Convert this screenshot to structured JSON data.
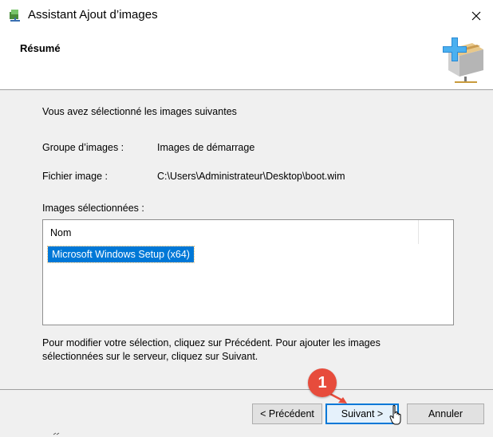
{
  "window": {
    "title": "Assistant Ajout d’images",
    "close_icon": "close-icon",
    "app_icon": "network-wizard-icon"
  },
  "header": {
    "title": "Résumé",
    "icon": "add-image-box-icon"
  },
  "summary": {
    "intro": "Vous avez sélectionné les images suivantes",
    "group_label": "Groupe d’images :",
    "group_value": "Images de démarrage",
    "file_label": "Fichier image :",
    "file_value": "C:\\Users\\Administrateur\\Desktop\\boot.wim",
    "selected_label": "Images sélectionnées :"
  },
  "image_list": {
    "column": "Nom",
    "rows": [
      "Microsoft Windows Setup (x64)"
    ]
  },
  "help_text": "Pour modifier votre sélection, cliquez sur Précédent. Pour ajouter les images sélectionnées sur le serveur, cliquez sur Suivant.",
  "buttons": {
    "previous": "< Précédent",
    "next": "Suivant >",
    "cancel": "Annuler"
  },
  "annotation": {
    "step_number": "1",
    "color": "#e74c3c"
  },
  "colors": {
    "selection": "#0078d7",
    "badge": "#e74c3c"
  }
}
